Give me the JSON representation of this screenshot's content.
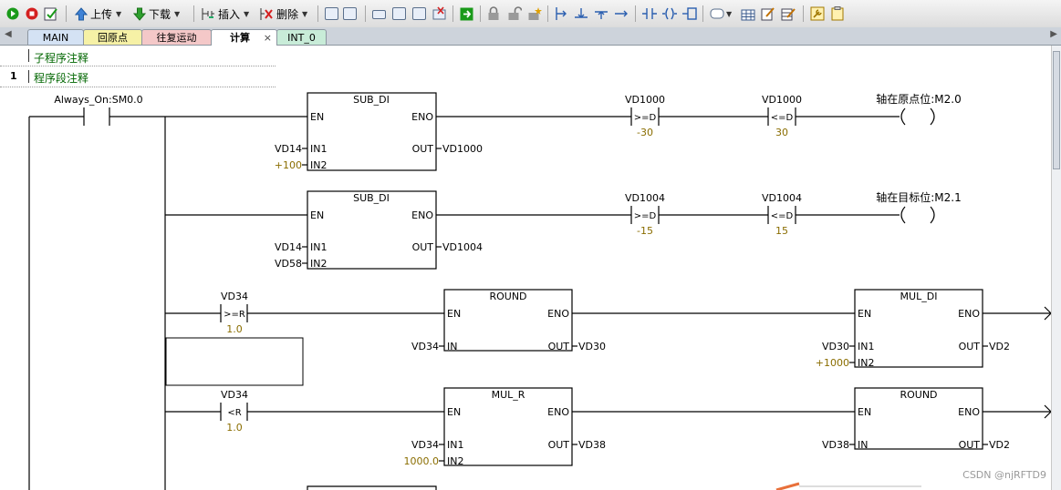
{
  "toolbar": {
    "upload_label": "上传",
    "download_label": "下载",
    "insert_label": "插入",
    "delete_label": "删除"
  },
  "tabs": [
    {
      "label": "MAIN",
      "color": "#d4e2f4"
    },
    {
      "label": "回原点",
      "color": "#f6f1a6"
    },
    {
      "label": "往复运动",
      "color": "#f4c8c8"
    },
    {
      "label": "计算",
      "color": "#ffffff"
    },
    {
      "label": "INT_0",
      "color": "#c8ecd8"
    }
  ],
  "tab_close_symbol": "×",
  "editor": {
    "subroutine_comment": "子程序注释",
    "network_number": "1",
    "network_comment": "程序段注释"
  },
  "ladder": {
    "power_contact": {
      "label": "Always_On:SM0.0"
    },
    "box1": {
      "title": "SUB_DI",
      "en": "EN",
      "eno": "ENO",
      "in1": "IN1",
      "in2": "IN2",
      "out": "OUT",
      "in1_val": "VD14",
      "in2_val": "+100",
      "out_val": "VD1000"
    },
    "box2": {
      "title": "SUB_DI",
      "en": "EN",
      "eno": "ENO",
      "in1": "IN1",
      "in2": "IN2",
      "out": "OUT",
      "in1_val": "VD14",
      "in2_val": "VD58",
      "out_val": "VD1004"
    },
    "cmp1": {
      "operand": "VD1000",
      "op": ">=D",
      "value": "-30"
    },
    "cmp2": {
      "operand": "VD1000",
      "op": "<=D",
      "value": "30"
    },
    "coil1": {
      "label": "轴在原点位:M2.0"
    },
    "cmp3": {
      "operand": "VD1004",
      "op": ">=D",
      "value": "-15"
    },
    "cmp4": {
      "operand": "VD1004",
      "op": "<=D",
      "value": "15"
    },
    "coil2": {
      "label": "轴在目标位:M2.1"
    },
    "cmp5": {
      "operand": "VD34",
      "op": ">=R",
      "value": "1.0"
    },
    "box3": {
      "title": "ROUND",
      "en": "EN",
      "eno": "ENO",
      "in": "IN",
      "out": "OUT",
      "in_val": "VD34",
      "out_val": "VD30"
    },
    "box4": {
      "title": "MUL_DI",
      "en": "EN",
      "eno": "ENO",
      "in1": "IN1",
      "in2": "IN2",
      "out": "OUT",
      "in1_val": "VD30",
      "in2_val": "+1000",
      "out_val": "VD2"
    },
    "cmp6": {
      "operand": "VD34",
      "op": "<R",
      "value": "1.0"
    },
    "box5": {
      "title": "MUL_R",
      "en": "EN",
      "eno": "ENO",
      "in1": "IN1",
      "in2": "IN2",
      "out": "OUT",
      "in1_val": "VD34",
      "in2_val": "1000.0",
      "out_val": "VD38"
    },
    "box6": {
      "title": "ROUND",
      "en": "EN",
      "eno": "ENO",
      "in": "IN",
      "out": "OUT",
      "in_val": "VD38",
      "out_val": "VD2"
    }
  },
  "colors": {
    "wire": "#000000",
    "constant": "#8a6d00",
    "comment": "#006600"
  },
  "watermark": "CSDN @njRFTD9"
}
